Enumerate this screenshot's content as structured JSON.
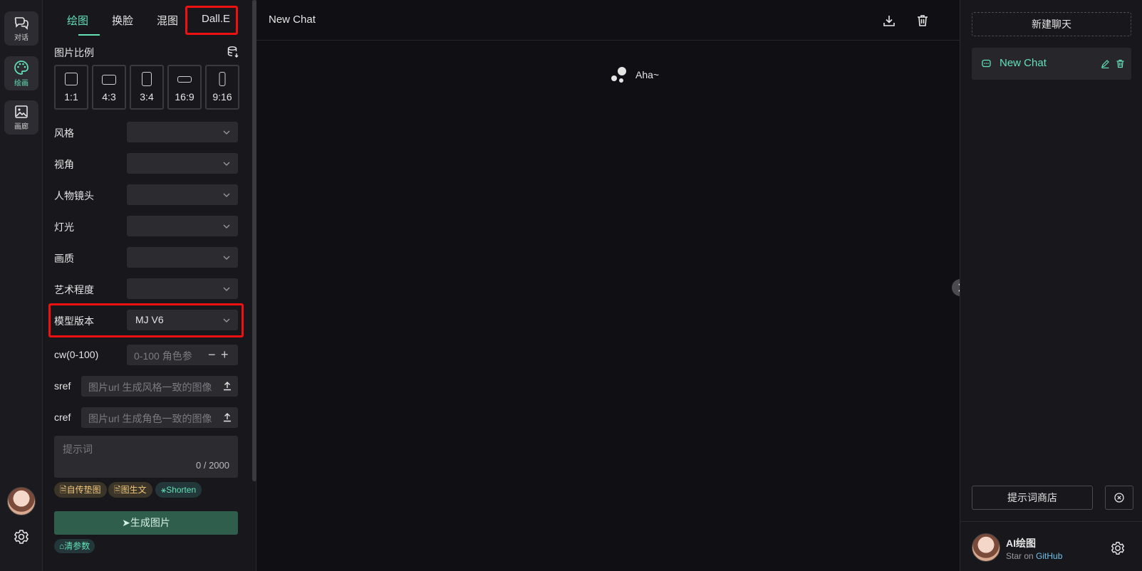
{
  "rail": {
    "items": [
      {
        "label": "对话",
        "icon": "chat-bubbles-icon"
      },
      {
        "label": "绘画",
        "icon": "palette-icon"
      },
      {
        "label": "画廊",
        "icon": "image-icon"
      }
    ]
  },
  "panel": {
    "tabs": [
      "绘图",
      "换脸",
      "混图",
      "Dall.E"
    ],
    "aspect_title": "图片比例",
    "ratios": [
      "1:1",
      "4:3",
      "3:4",
      "16:9",
      "9:16"
    ],
    "rows": [
      {
        "label": "风格",
        "value": ""
      },
      {
        "label": "视角",
        "value": ""
      },
      {
        "label": "人物镜头",
        "value": ""
      },
      {
        "label": "灯光",
        "value": ""
      },
      {
        "label": "画质",
        "value": ""
      },
      {
        "label": "艺术程度",
        "value": ""
      },
      {
        "label": "模型版本",
        "value": "MJ V6"
      }
    ],
    "cw": {
      "label": "cw(0-100)",
      "placeholder": "0-100 角色参"
    },
    "sref": {
      "label": "sref",
      "placeholder": "图片url 生成风格一致的图像"
    },
    "cref": {
      "label": "cref",
      "placeholder": "图片url 生成角色一致的图像"
    },
    "prompt": {
      "placeholder": "提示词",
      "count": "0 / 2000"
    },
    "chips": [
      "自传垫图",
      "图生文",
      "Shorten"
    ],
    "generate_label": "生成图片",
    "clear_label": "清参数"
  },
  "center": {
    "title": "New Chat",
    "greeting": "Aha~"
  },
  "right": {
    "new_chat_label": "新建聊天",
    "chat_item_label": "New Chat",
    "store_label": "提示词商店",
    "user_name": "AI绘图",
    "user_sub_prefix": "Star on",
    "user_sub_link": "GitHub"
  },
  "colors": {
    "accent": "#63e2b7",
    "highlight": "#e11111",
    "background": "#101014"
  }
}
